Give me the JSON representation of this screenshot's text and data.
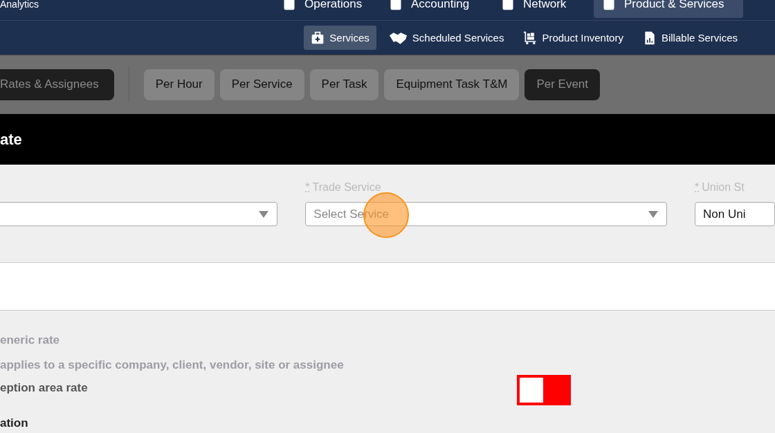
{
  "top_nav": {
    "items": [
      {
        "label": "Analytics",
        "selected": false
      },
      {
        "label": "Operations",
        "selected": false
      },
      {
        "label": "Accounting",
        "selected": false
      },
      {
        "label": "Network",
        "selected": false
      },
      {
        "label": "Product & Services",
        "selected": true
      }
    ]
  },
  "sub_nav": {
    "items": [
      {
        "label": "Services",
        "selected": true
      },
      {
        "label": "Scheduled Services",
        "selected": false
      },
      {
        "label": "Product Inventory",
        "selected": false
      },
      {
        "label": "Billable Services",
        "selected": false
      }
    ]
  },
  "rate_tabs": [
    {
      "label": "Rates & Assignees",
      "selected": true
    },
    {
      "label": "Per Hour",
      "selected": false
    },
    {
      "label": "Per Service",
      "selected": false
    },
    {
      "label": "Per Task",
      "selected": false
    },
    {
      "label": "Equipment Task T&M",
      "selected": false
    },
    {
      "label": "Per Event",
      "selected": true
    }
  ],
  "panel": {
    "title": "ate"
  },
  "fields": [
    {
      "kind": "select"
    },
    {
      "kind": "select",
      "required_mark": "*",
      "label": "Trade Service",
      "placeholder": "Select Service"
    },
    {
      "kind": "select",
      "required_mark": "*",
      "label": "Union St",
      "value": "Non Uni"
    }
  ],
  "options": [
    {
      "text": "eneric rate",
      "disabled": true
    },
    {
      "text": "applies to a specific company, client, vendor, site or assignee",
      "disabled": true
    },
    {
      "text": "eption area rate",
      "disabled": false
    }
  ],
  "toggle": {
    "on": false
  },
  "section": {
    "title": "ation"
  }
}
